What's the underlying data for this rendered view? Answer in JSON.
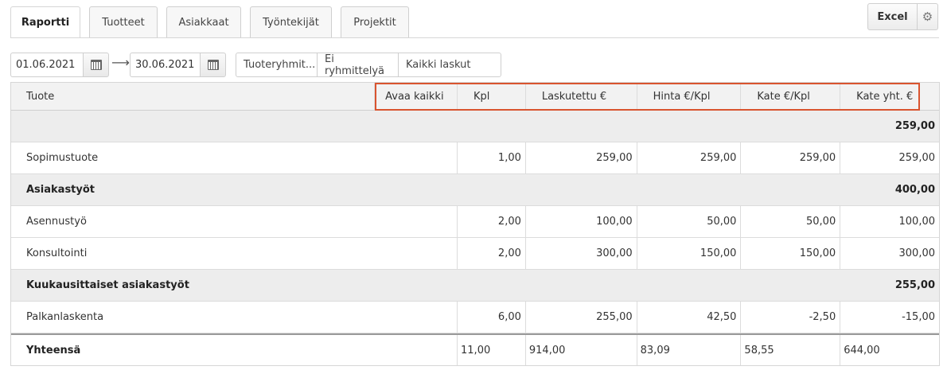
{
  "tabs": [
    {
      "label": "Raportti",
      "active": true
    },
    {
      "label": "Tuotteet",
      "active": false
    },
    {
      "label": "Asiakkaat",
      "active": false
    },
    {
      "label": "Työntekijät",
      "active": false
    },
    {
      "label": "Projektit",
      "active": false
    }
  ],
  "toolbar": {
    "excel_label": "Excel",
    "settings_icon": "gear-icon"
  },
  "filters": {
    "start_date": "01.06.2021",
    "end_date": "30.06.2021",
    "arrow": "⟶",
    "product_group": "Tuoteryhmit...",
    "grouping": "Ei ryhmittelyä",
    "invoices": "Kaikki laskut"
  },
  "table": {
    "headers": {
      "product": "Tuote",
      "expand_all": "Avaa kaikki",
      "qty": "Kpl",
      "invoiced": "Laskutettu €",
      "price": "Hinta €/Kpl",
      "margin": "Kate €/Kpl",
      "margin_total": "Kate yht. €"
    },
    "groups": [
      {
        "name": "",
        "total": "259,00",
        "rows": [
          {
            "product": "Sopimustuote",
            "qty": "1,00",
            "invoiced": "259,00",
            "price": "259,00",
            "margin": "259,00",
            "margin_total": "259,00"
          }
        ]
      },
      {
        "name": "Asiakastyöt",
        "total": "400,00",
        "rows": [
          {
            "product": "Asennustyö",
            "qty": "2,00",
            "invoiced": "100,00",
            "price": "50,00",
            "margin": "50,00",
            "margin_total": "100,00"
          },
          {
            "product": "Konsultointi",
            "qty": "2,00",
            "invoiced": "300,00",
            "price": "150,00",
            "margin": "150,00",
            "margin_total": "300,00"
          }
        ]
      },
      {
        "name": "Kuukausittaiset asiakastyöt",
        "total": "255,00",
        "rows": [
          {
            "product": "Palkanlaskenta",
            "qty": "6,00",
            "invoiced": "255,00",
            "price": "42,50",
            "margin": "-2,50",
            "margin_total": "-15,00"
          }
        ]
      }
    ],
    "totals": {
      "label": "Yhteensä",
      "qty": "11,00",
      "invoiced": "914,00",
      "price": "83,09",
      "margin": "58,55",
      "margin_total": "644,00"
    }
  },
  "colors": {
    "highlight": "#d9542f",
    "link": "#3b7bbf"
  }
}
